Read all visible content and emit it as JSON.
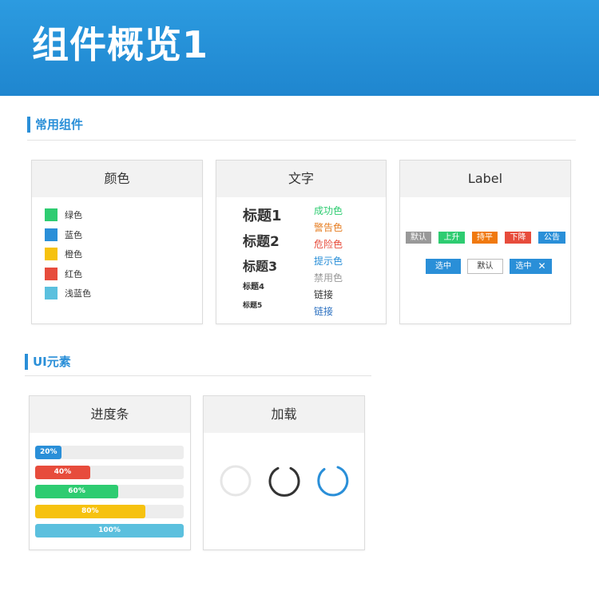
{
  "header": {
    "title": "组件概览1",
    "bg_color": "#2489d4"
  },
  "sections": {
    "common": "常用组件",
    "ui": "UI元素"
  },
  "colors_card": {
    "title": "颜色",
    "items": [
      {
        "label": "绿色",
        "color": "#2ecc71"
      },
      {
        "label": "蓝色",
        "color": "#2a8fd8"
      },
      {
        "label": "橙色",
        "color": "#f6c20f"
      },
      {
        "label": "红色",
        "color": "#e74c3c"
      },
      {
        "label": "浅蓝色",
        "color": "#5bc0de"
      }
    ]
  },
  "text_card": {
    "title": "文字",
    "headings": [
      "标题1",
      "标题2",
      "标题3",
      "标题4",
      "标题5"
    ],
    "colored": [
      {
        "label": "成功色",
        "color": "#2ecc71"
      },
      {
        "label": "警告色",
        "color": "#e67e22"
      },
      {
        "label": "危险色",
        "color": "#e74c3c"
      },
      {
        "label": "提示色",
        "color": "#2a8fd8"
      },
      {
        "label": "禁用色",
        "color": "#999999"
      },
      {
        "label": "链接",
        "color": "#333333"
      },
      {
        "label": "链接",
        "color": "#2a6fc0"
      }
    ]
  },
  "label_card": {
    "title": "Label",
    "tags": [
      {
        "label": "默认",
        "color": "#999999"
      },
      {
        "label": "上升",
        "color": "#2ecc71"
      },
      {
        "label": "持平",
        "color": "#f0790f"
      },
      {
        "label": "下降",
        "color": "#e74c3c"
      },
      {
        "label": "公告",
        "color": "#2a8fd8"
      }
    ],
    "chips": [
      {
        "label": "选中"
      },
      {
        "label": "默认"
      },
      {
        "label": "选中",
        "close": "✕"
      }
    ]
  },
  "progress_card": {
    "title": "进度条",
    "bars": [
      {
        "label": "20%",
        "value": 0.18,
        "color": "#2a8fd8"
      },
      {
        "label": "40%",
        "value": 0.37,
        "color": "#e74c3c"
      },
      {
        "label": "60%",
        "value": 0.56,
        "color": "#2ecc71"
      },
      {
        "label": "80%",
        "value": 0.74,
        "color": "#f6c20f"
      },
      {
        "label": "100%",
        "value": 1.0,
        "color": "#5bc0de"
      }
    ]
  },
  "loading_card": {
    "title": "加载",
    "spinners": [
      {
        "name": "light",
        "track": "#e6e6e6",
        "arc": "#e6e6e6"
      },
      {
        "name": "dark",
        "track": "#ffffff",
        "arc": "#333333"
      },
      {
        "name": "blue",
        "track": "#ffffff",
        "arc": "#2a8fd8"
      }
    ]
  }
}
